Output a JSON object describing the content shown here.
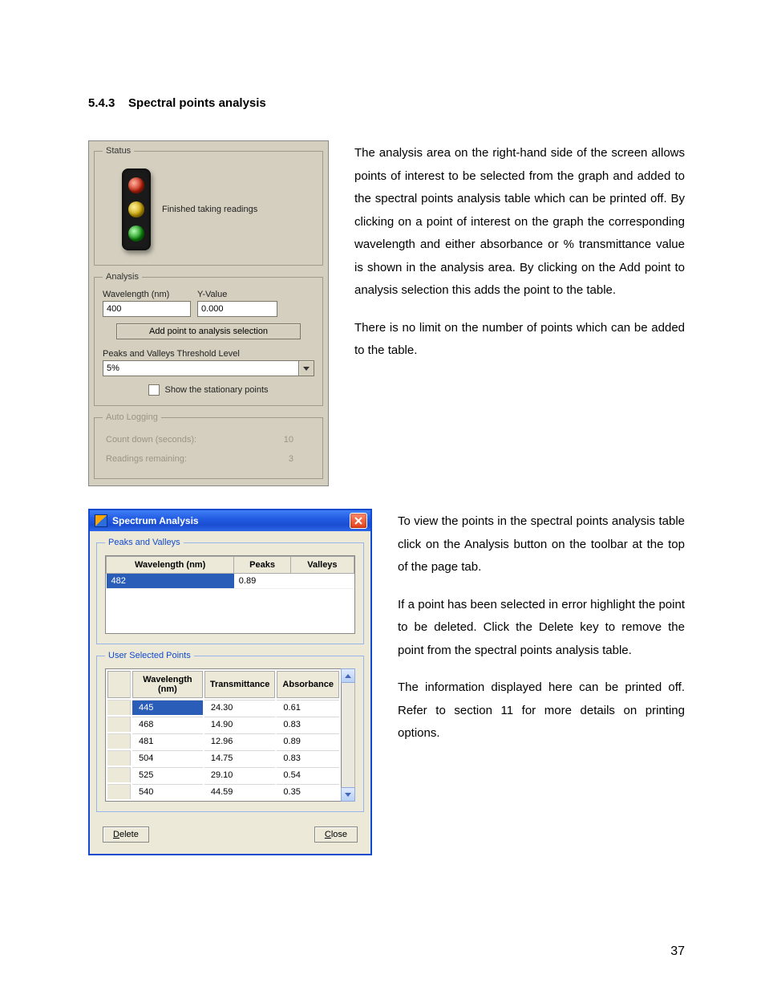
{
  "heading": {
    "number": "5.4.3",
    "title": "Spectral points analysis"
  },
  "panel1": {
    "status": {
      "legend": "Status",
      "text": "Finished taking readings"
    },
    "analysis": {
      "legend": "Analysis",
      "wavelength_label": "Wavelength (nm)",
      "wavelength_value": "400",
      "yvalue_label": "Y-Value",
      "yvalue_value": "0.000",
      "add_point_btn": "Add point to analysis selection",
      "threshold_label": "Peaks and Valleys Threshold Level",
      "threshold_value": "5%",
      "show_stationary": "Show the stationary points"
    },
    "auto_logging": {
      "legend": "Auto Logging",
      "countdown_label": "Count down (seconds):",
      "countdown_value": "10",
      "remaining_label": "Readings remaining:",
      "remaining_value": "3"
    }
  },
  "para1": {
    "p1": "The analysis area on the right-hand side of the screen allows points of interest to be selected from the graph and added to the spectral points analysis table which can be printed off.  By clicking on a point of interest on the graph the corresponding wavelength and either absorbance or % transmittance value is shown in the analysis area. By clicking on the Add point to analysis selection this adds the point to the table.",
    "p2": "There is no limit on the number of points which can be added to the table."
  },
  "dialog": {
    "title": "Spectrum Analysis",
    "peaks_valleys": {
      "legend": "Peaks and Valleys",
      "headers": [
        "Wavelength (nm)",
        "Peaks",
        "Valleys"
      ],
      "rows": [
        [
          "482",
          "0.89",
          ""
        ]
      ]
    },
    "user_points": {
      "legend": "User Selected Points",
      "headers": [
        "Wavelength (nm)",
        "Transmittance",
        "Absorbance"
      ],
      "rows": [
        [
          "445",
          "24.30",
          "0.61"
        ],
        [
          "468",
          "14.90",
          "0.83"
        ],
        [
          "481",
          "12.96",
          "0.89"
        ],
        [
          "504",
          "14.75",
          "0.83"
        ],
        [
          "525",
          "29.10",
          "0.54"
        ],
        [
          "540",
          "44.59",
          "0.35"
        ]
      ]
    },
    "delete_btn": "Delete",
    "close_btn": "Close"
  },
  "para2": {
    "p1": "To view the points in the spectral points analysis table click on the Analysis button on the toolbar at the top of the page tab.",
    "p2": "If a point has been selected in error highlight the point to be deleted. Click the Delete key to remove the point from the spectral points analysis table.",
    "p3": "The information displayed here can be printed off. Refer to section 11 for more details on printing options."
  },
  "page_number": "37"
}
